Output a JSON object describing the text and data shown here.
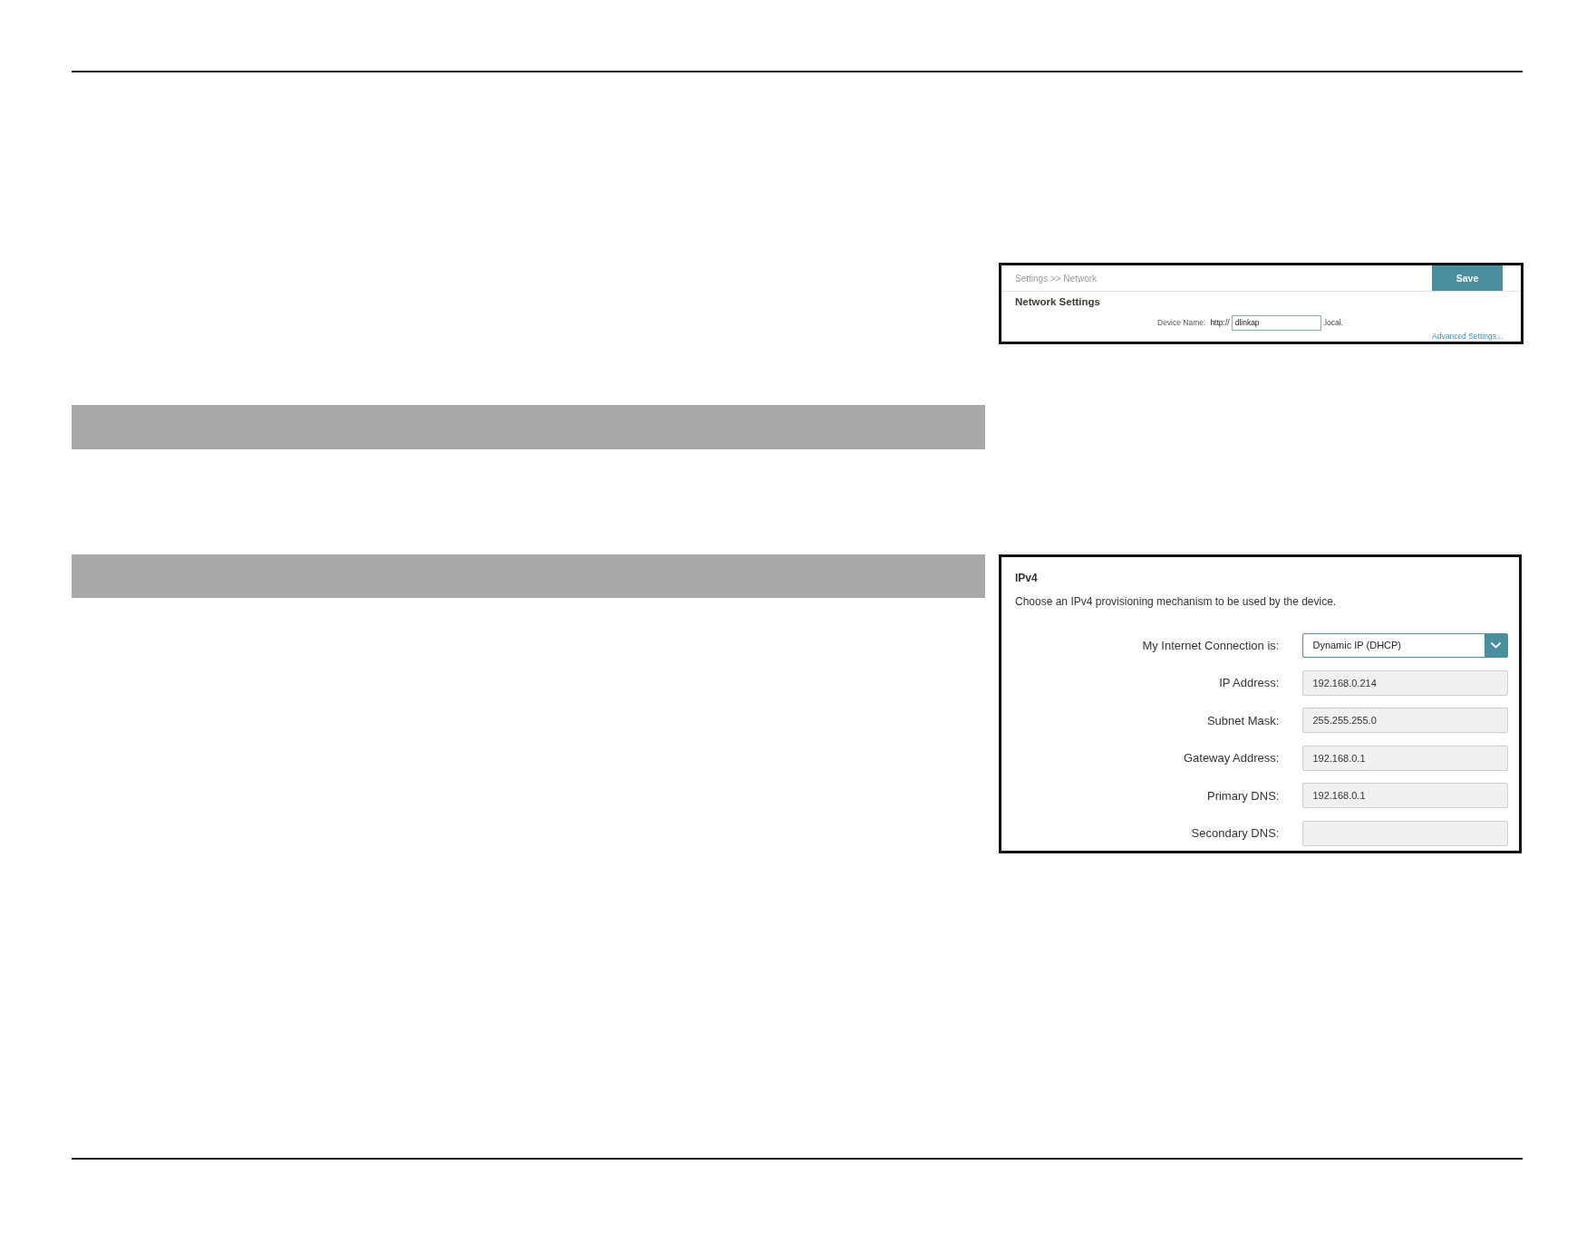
{
  "settings_panel": {
    "breadcrumb": "Settings >> Network",
    "save_button": "Save",
    "title": "Network Settings",
    "device_name": {
      "label": "Device Name:",
      "prefix": "http://",
      "value": "dlinkap",
      "suffix": ".local."
    },
    "advanced_link": "Advanced Settings..."
  },
  "ipv4_panel": {
    "title": "IPv4",
    "description": "Choose an IPv4 provisioning mechanism to be used by the device.",
    "fields": [
      {
        "kind": "dropdown",
        "label": "My Internet Connection is:",
        "value": "Dynamic IP (DHCP)"
      },
      {
        "kind": "text",
        "label": "IP Address:",
        "value": "192.168.0.214"
      },
      {
        "kind": "text",
        "label": "Subnet Mask:",
        "value": "255.255.255.0"
      },
      {
        "kind": "text",
        "label": "Gateway Address:",
        "value": "192.168.0.1"
      },
      {
        "kind": "text",
        "label": "Primary DNS:",
        "value": "192.168.0.1"
      },
      {
        "kind": "text",
        "label": "Secondary DNS:"
      }
    ]
  }
}
